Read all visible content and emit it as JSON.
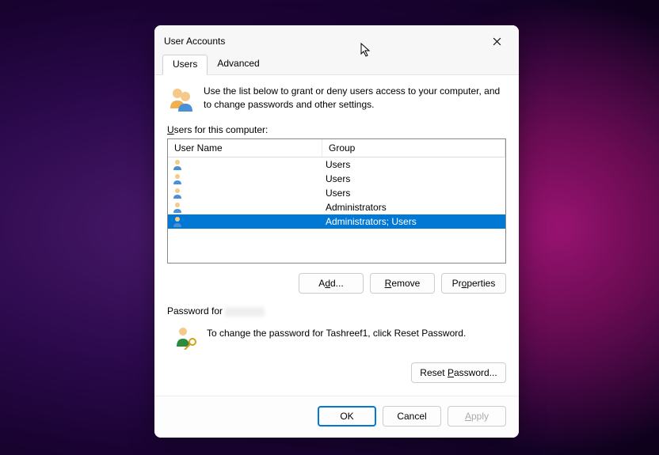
{
  "dialog": {
    "title": "User Accounts",
    "tabs": [
      "Users",
      "Advanced"
    ],
    "intro": "Use the list below to grant or deny users access to your computer, and to change passwords and other settings.",
    "users_label": "Users for this computer:",
    "columns": {
      "name": "User Name",
      "group": "Group"
    },
    "rows": [
      {
        "name": "",
        "group": "Users",
        "selected": false
      },
      {
        "name": "",
        "group": "Users",
        "selected": false
      },
      {
        "name": "",
        "group": "Users",
        "selected": false
      },
      {
        "name": "",
        "group": "Administrators",
        "selected": false
      },
      {
        "name": "",
        "group": "Administrators; Users",
        "selected": true
      }
    ],
    "buttons": {
      "add": "Add...",
      "remove": "Remove",
      "properties": "Properties"
    },
    "password_section": {
      "label_prefix": "Password for",
      "text": "To change the password for Tashreef1, click Reset Password.",
      "reset": "Reset Password..."
    },
    "footer": {
      "ok": "OK",
      "cancel": "Cancel",
      "apply": "Apply"
    }
  }
}
